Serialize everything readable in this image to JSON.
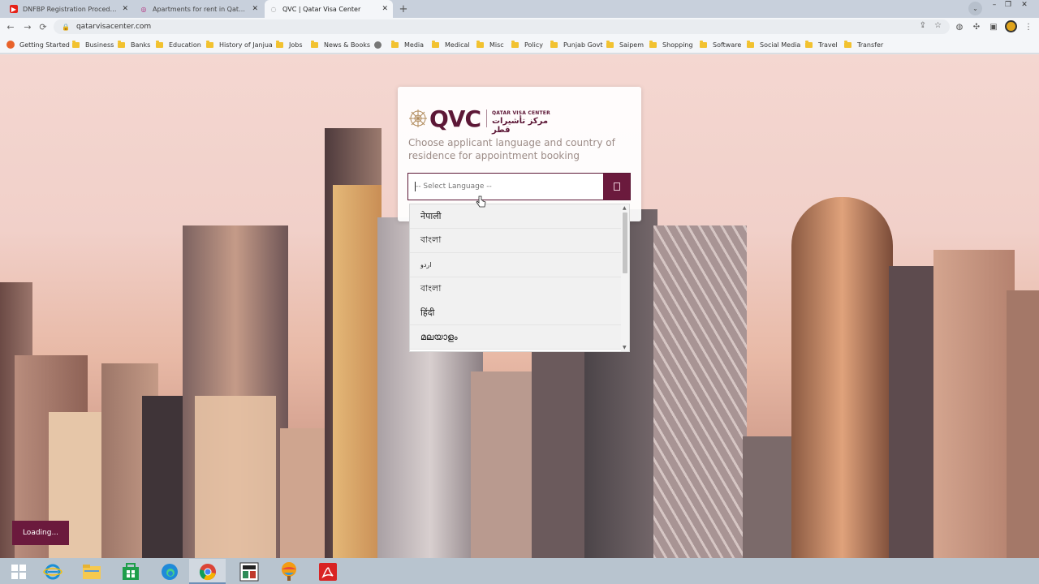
{
  "browser": {
    "tabs": [
      {
        "title": "DNFBP Registration Procedure |",
        "favicon": "youtube-icon",
        "favicon_color": "#e62117",
        "active": false
      },
      {
        "title": "Apartments for rent in Qatar | Q",
        "favicon": "listing-icon",
        "favicon_color": "#b3287a",
        "active": false
      },
      {
        "title": "QVC | Qatar Visa Center",
        "favicon": "loading-spinner-icon",
        "favicon_color": "#666666",
        "active": true
      }
    ],
    "url": "qatarvisacenter.com",
    "bookmarks": [
      {
        "label": "Getting Started",
        "icon": "firefox-icon"
      },
      {
        "label": "Business",
        "icon": "folder-icon"
      },
      {
        "label": "Banks",
        "icon": "folder-icon"
      },
      {
        "label": "Education",
        "icon": "folder-icon"
      },
      {
        "label": "History of Janjua",
        "icon": "folder-icon"
      },
      {
        "label": "Jobs",
        "icon": "folder-icon"
      },
      {
        "label": "News & Books",
        "icon": "folder-icon"
      },
      {
        "label": "",
        "icon": "globe-icon"
      },
      {
        "label": "Media",
        "icon": "folder-icon"
      },
      {
        "label": "Medical",
        "icon": "folder-icon"
      },
      {
        "label": "Misc",
        "icon": "folder-icon"
      },
      {
        "label": "Policy",
        "icon": "folder-icon"
      },
      {
        "label": "Punjab Govt",
        "icon": "folder-icon"
      },
      {
        "label": "Saipem",
        "icon": "folder-icon"
      },
      {
        "label": "Shopping",
        "icon": "folder-icon"
      },
      {
        "label": "Software",
        "icon": "folder-icon"
      },
      {
        "label": "Social Media",
        "icon": "folder-icon"
      },
      {
        "label": "Travel",
        "icon": "folder-icon"
      },
      {
        "label": "Transfer",
        "icon": "folder-icon"
      }
    ]
  },
  "page": {
    "logo": {
      "mark": "QVC",
      "en": "QATAR VISA CENTER",
      "ar": "مركز تأشيرات قطر"
    },
    "instruction": "Choose applicant language and country of residence for appointment booking",
    "language_select": {
      "placeholder": "-- Select Language --",
      "options": [
        "नेपाली",
        "বাংলা",
        "اردو",
        "বাংলা",
        "हिंदी",
        "മലയാളം"
      ]
    },
    "loading_text": "Loading..."
  },
  "colors": {
    "brand": "#5c1736",
    "button": "#6b1a3d"
  },
  "taskbar": {
    "apps": [
      {
        "name": "windows-start-icon"
      },
      {
        "name": "internet-explorer-icon"
      },
      {
        "name": "file-explorer-icon"
      },
      {
        "name": "store-icon"
      },
      {
        "name": "edge-icon"
      },
      {
        "name": "chrome-icon",
        "active": true
      },
      {
        "name": "app-icon"
      },
      {
        "name": "paint-icon"
      },
      {
        "name": "acrobat-icon"
      }
    ]
  }
}
